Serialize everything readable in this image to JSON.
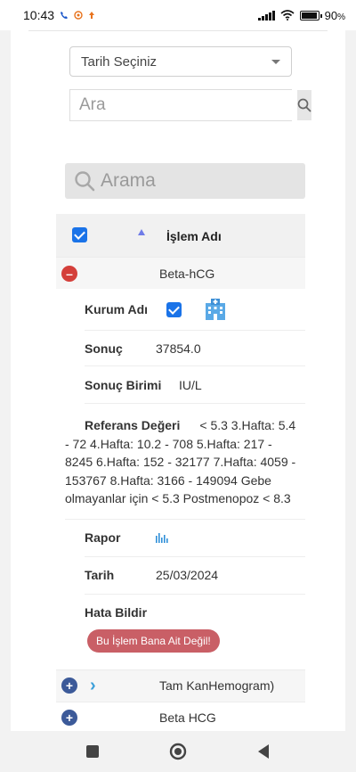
{
  "status_bar": {
    "time": "10:43",
    "battery": "90",
    "battery_unit": "%"
  },
  "date_select": {
    "value": "Tarih Seçiniz"
  },
  "top_search": {
    "placeholder": "Ara"
  },
  "table_search": {
    "placeholder": "Arama"
  },
  "table": {
    "header": {
      "title": "İşlem Adı",
      "select_all_checked": true
    },
    "expanded_row": {
      "name": "Beta-hCG",
      "details": {
        "institution": {
          "label": "Kurum Adı",
          "checked": true,
          "icon": "hospital-icon"
        },
        "result": {
          "label": "Sonuç",
          "value": "37854.0"
        },
        "unit": {
          "label": "Sonuç Birimi",
          "value": "IU/L"
        },
        "reference": {
          "label": "Referans Değeri",
          "value": "< 5.3 3.Hafta: 5.4 - 72 4.Hafta: 10.2 - 708 5.Hafta: 217 - 8245 6.Hafta: 152 - 32177 7.Hafta: 4059 - 153767 8.Hafta: 3166 - 149094 Gebe olmayanlar için < 5.3 Postmenopoz < 8.3"
        },
        "report": {
          "label": "Rapor",
          "icon": "bar-chart-icon"
        },
        "date": {
          "label": "Tarih",
          "value": "25/03/2024"
        },
        "report_error": {
          "label": "Hata Bildir",
          "button": "Bu İşlem Bana Ait Değil!"
        }
      }
    },
    "rows": [
      {
        "name": "Tam KanHemogram)"
      },
      {
        "name": "Beta HCG"
      }
    ]
  },
  "colors": {
    "accent_blue": "#1a73e8",
    "minus_red": "#d43f3a",
    "plus_blue": "#3c5a99",
    "badge": "#c95f66"
  }
}
